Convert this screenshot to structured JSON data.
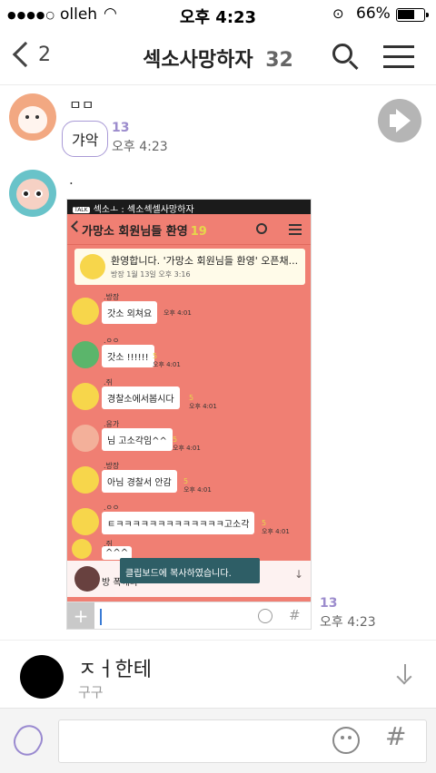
{
  "status_bar": {
    "signal": "●●●●○",
    "carrier": "olleh",
    "time": "오후 4:23",
    "battery": "66%",
    "battery_level": 0.66
  },
  "header": {
    "back_count": "2",
    "title": "섹소사망하자",
    "member_count": "32"
  },
  "messages": [
    {
      "sender": "ㅁㅁ",
      "text": "갸악",
      "unread": "13",
      "time": "오후 4:23"
    },
    {
      "sender": ".",
      "unread": "13",
      "time": "오후 4:23"
    }
  ],
  "embedded": {
    "status_title": "섹소ㅗ : 섹소섹셀사망하자",
    "status_tag": "TALK",
    "title": "가망소 회원님들 환영",
    "title_count": "19",
    "notice_text": "환영합니다. '가망소 회원님들 환영' 오픈채...",
    "notice_meta": "방장 1월 13일 오후 3:16",
    "rows": [
      {
        "name": ".방장",
        "text": "갓소 외쳐요",
        "unread": "",
        "time": "오후 4:01"
      },
      {
        "name": ".ㅇㅇ",
        "text": "갓소 !!!!!!",
        "unread": "5",
        "time": "오후 4:01"
      },
      {
        "name": ".쥐",
        "text": "경찰소에서봅시다",
        "unread": "5",
        "time": "오후 4:01"
      },
      {
        "name": ".응가",
        "text": "님 고소각임^^",
        "unread": "5",
        "time": "오후 4:01"
      },
      {
        "name": ".방장",
        "text": "아님 경찰서 안감",
        "unread": "5",
        "time": "오후 4:01"
      },
      {
        "name": ".ㅇㅇ",
        "text": "ㅌㅋㅋㅋㅋㅋㅋㅋㅋㅋㅋㅋㅋㅋ고소각",
        "unread": "5",
        "time": "오후 4:01"
      },
      {
        "name": ".쥐",
        "text": "^^^",
        "unread": "",
        "time": ""
      }
    ],
    "last_line": "방 폭해라",
    "toast": "클립보드에 복사하였습니다."
  },
  "mention_popup": {
    "name": "ㅈㅓ한테",
    "subtitle": "구구"
  },
  "colors": {
    "accent": "#9c8ccd",
    "embedded_bg": "#f07f73"
  }
}
